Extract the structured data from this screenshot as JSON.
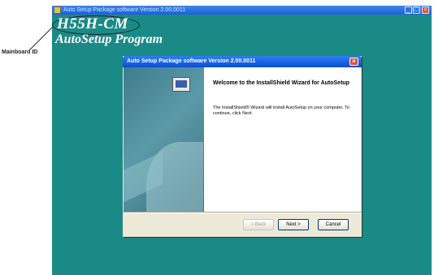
{
  "annotation": {
    "label": "Mainboard ID"
  },
  "app_window": {
    "title": "Auto Setup Package software Version 2.00.0011",
    "controls": {
      "minimize": "_",
      "maximize": "□",
      "close": "×"
    }
  },
  "heading": {
    "model": "H55H-CM",
    "program": "AutoSetup Program"
  },
  "dialog": {
    "title": "Auto Setup Package software Version 2.00.0011",
    "welcome_title": "Welcome to the InstallShield Wizard for AutoSetup",
    "welcome_text": "The InstallShield® Wizard will install AutoSetup on your computer.  To continue, click Next.",
    "buttons": {
      "back": "< Back",
      "next": "Next >",
      "cancel": "Cancel"
    }
  },
  "colors": {
    "desktop": "#1a8a86",
    "titlebar": "#0a4fd0",
    "dialog_bg": "#ece9d8"
  },
  "icons": [
    "installshield-monitor-icon",
    "close-icon",
    "minimize-icon",
    "maximize-icon"
  ]
}
